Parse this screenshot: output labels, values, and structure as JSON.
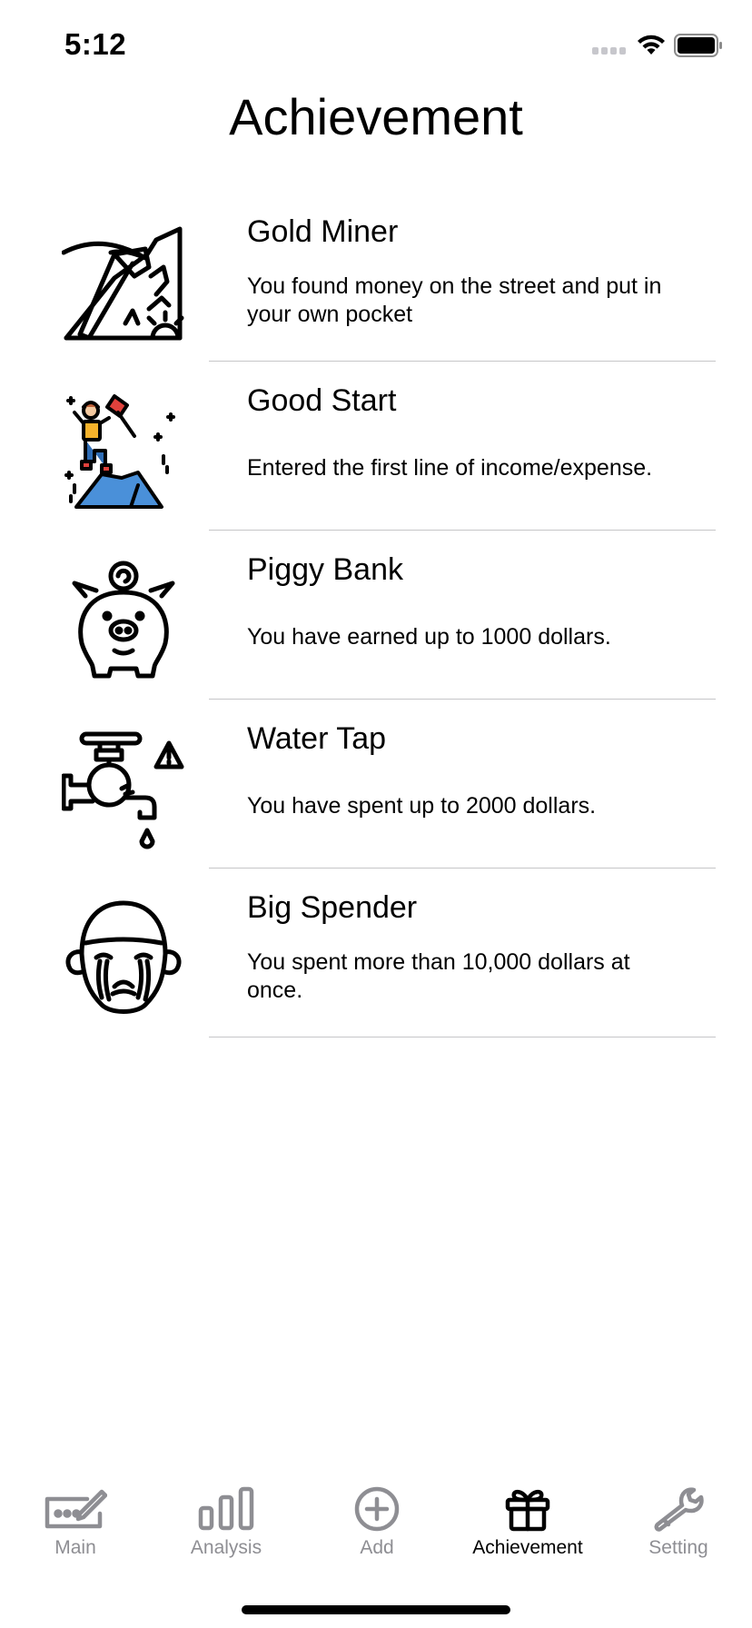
{
  "status_bar": {
    "time": "5:12"
  },
  "header": {
    "title": "Achievement"
  },
  "achievements": [
    {
      "title": "Gold Miner",
      "description": "You found money on the street and put in your own pocket",
      "icon": "pickaxe-mountain-icon"
    },
    {
      "title": "Good Start",
      "description": "Entered the first line of income/expense.",
      "icon": "climber-flag-icon"
    },
    {
      "title": "Piggy Bank",
      "description": "You have earned up to 1000 dollars.",
      "icon": "piggy-bank-icon"
    },
    {
      "title": "Water Tap",
      "description": "You have spent up to 2000 dollars.",
      "icon": "water-tap-icon"
    },
    {
      "title": "Big Spender",
      "description": "You spent more than 10,000 dollars at once.",
      "icon": "crying-face-icon"
    }
  ],
  "tab_bar": {
    "active": "Achievement",
    "tabs": [
      {
        "label": "Main",
        "icon": "keyboard-pen-icon"
      },
      {
        "label": "Analysis",
        "icon": "bar-chart-icon"
      },
      {
        "label": "Add",
        "icon": "plus-circle-icon"
      },
      {
        "label": "Achievement",
        "icon": "gift-icon"
      },
      {
        "label": "Setting",
        "icon": "wrench-icon"
      }
    ]
  },
  "colors": {
    "active_tab": "#000000",
    "inactive_tab": "#8e8e93",
    "divider": "#c6c6c8",
    "climber_shirt": "#f7b32b",
    "climber_pants": "#2f6db5",
    "mountain": "#4a90d9",
    "flag": "#e0413c"
  }
}
